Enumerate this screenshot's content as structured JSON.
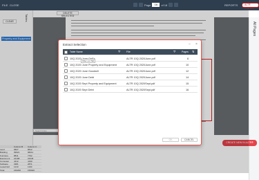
{
  "topbar": {
    "tabs": [
      "FILE",
      "CLOSE"
    ],
    "page_label": "Page",
    "page_value": "16",
    "page_total": "of 18",
    "right_tab": "REPORTS",
    "alt_pill": "ALT® FOR ALL",
    "colors": {
      "bg": "#2f3e4e",
      "accent": "#e5434b"
    }
  },
  "toolbar": {
    "clear_label": "CLEAR",
    "delete_label": "DELETE SELECTED"
  },
  "left_panel": {
    "heading": "Tables",
    "item": "Property and Equipment"
  },
  "right_panel": {
    "heading": "All Pages"
  },
  "modal": {
    "title": "Extract Selection",
    "columns": {
      "name": "Table Name",
      "file": "File",
      "pages": "Pages"
    },
    "tooltip": "Filter out Tab",
    "rows": [
      {
        "name": "10Q 2020 June OpEx",
        "file": "ALTR 10Q 2020June.pdf",
        "page": "6"
      },
      {
        "name": "10Q 2020 June Property and Equipment",
        "file": "ALTR 10Q 2020June.pdf",
        "page": "10"
      },
      {
        "name": "10Q 2020 June Goodwill",
        "file": "ALTR 10Q 2020June.pdf",
        "page": "12"
      },
      {
        "name": "10Q 2020 June Debt",
        "file": "ALTR 10Q 2020June.pdf",
        "page": "14"
      },
      {
        "name": "10Q 2020 Sept Property and Equipment",
        "file": "ALTR 10Q 2020Sept.pdf",
        "page": "15"
      },
      {
        "name": "10Q 2020 Sept Debt",
        "file": "ALTR 10Q 2020Sept.pdf",
        "page": "16"
      }
    ],
    "ok_label": "OK",
    "cancel_label": "CANCEL"
  },
  "grid": {
    "headers": [
      "",
      "Column B",
      "Column C"
    ],
    "rows": [
      [
        "Land",
        "9827",
        "8812"
      ],
      [
        "Building",
        "99921",
        "98211"
      ],
      [
        "Furniture",
        "8811",
        "7762"
      ],
      [
        "Equipment",
        "22198",
        "23345"
      ],
      [
        "Computer",
        "4412",
        "4190"
      ],
      [
        "Software",
        "3381",
        "2871"
      ],
      [
        "Leasehold",
        "1210",
        "1190"
      ],
      [
        "Total",
        "166260",
        "156926"
      ]
    ]
  },
  "create_button": "CREATE NEW IN ALTR® TABLE",
  "search_placeholder": "Search Files"
}
